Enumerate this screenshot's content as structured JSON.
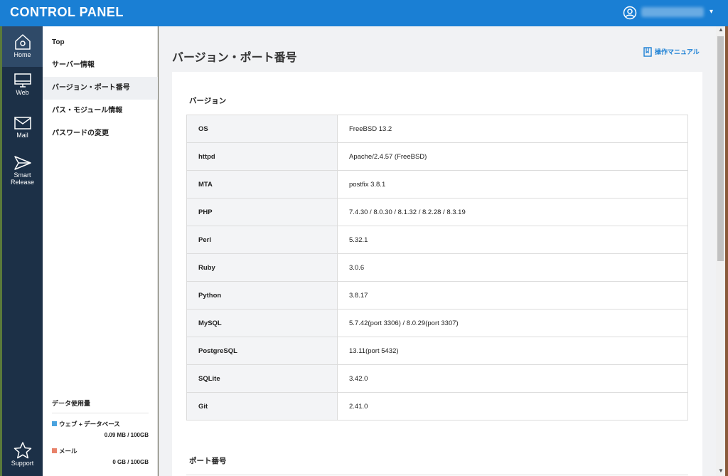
{
  "header": {
    "brand": "CONTROL PANEL",
    "user_menu": "▾"
  },
  "iconbar": [
    {
      "label": "Home",
      "icon": "home-icon"
    },
    {
      "label": "Web",
      "icon": "monitor-icon"
    },
    {
      "label": "Mail",
      "icon": "mail-icon"
    },
    {
      "label": "Smart Release",
      "label_lines": [
        "Smart",
        "Release"
      ],
      "icon": "send-icon"
    },
    {
      "label": "Support",
      "icon": "star-icon"
    }
  ],
  "subnav": {
    "items": [
      "Top",
      "サーバー情報",
      "バージョン・ポート番号",
      "パス・モジュール情報",
      "パスワードの変更"
    ],
    "active_index": 2
  },
  "usage": {
    "title": "データ使用量",
    "items": [
      {
        "label": "ウェブ + データベース",
        "value": "0.09 MB / 100GB",
        "color": "#4aa3df"
      },
      {
        "label": "メール",
        "value": "0 GB / 100GB",
        "color": "#e8826a"
      }
    ]
  },
  "main": {
    "title": "バージョン・ポート番号",
    "manual_link": "操作マニュアル",
    "version_section": "バージョン",
    "port_section": "ポート番号",
    "versions": [
      {
        "name": "OS",
        "value": "FreeBSD 13.2"
      },
      {
        "name": "httpd",
        "value": "Apache/2.4.57 (FreeBSD)"
      },
      {
        "name": "MTA",
        "value": "postfix 3.8.1"
      },
      {
        "name": "PHP",
        "value": "7.4.30 / 8.0.30 / 8.1.32 / 8.2.28 / 8.3.19"
      },
      {
        "name": "Perl",
        "value": "5.32.1"
      },
      {
        "name": "Ruby",
        "value": "3.0.6"
      },
      {
        "name": "Python",
        "value": "3.8.17"
      },
      {
        "name": "MySQL",
        "value": "5.7.42(port 3306) / 8.0.29(port 3307)"
      },
      {
        "name": "PostgreSQL",
        "value": "13.11(port 5432)"
      },
      {
        "name": "SQLite",
        "value": "3.42.0"
      },
      {
        "name": "Git",
        "value": "2.41.0"
      }
    ]
  },
  "colors": {
    "topbar": "#1a7fd4",
    "iconbar": "#1c3047",
    "accent": "#1a7fd4"
  }
}
